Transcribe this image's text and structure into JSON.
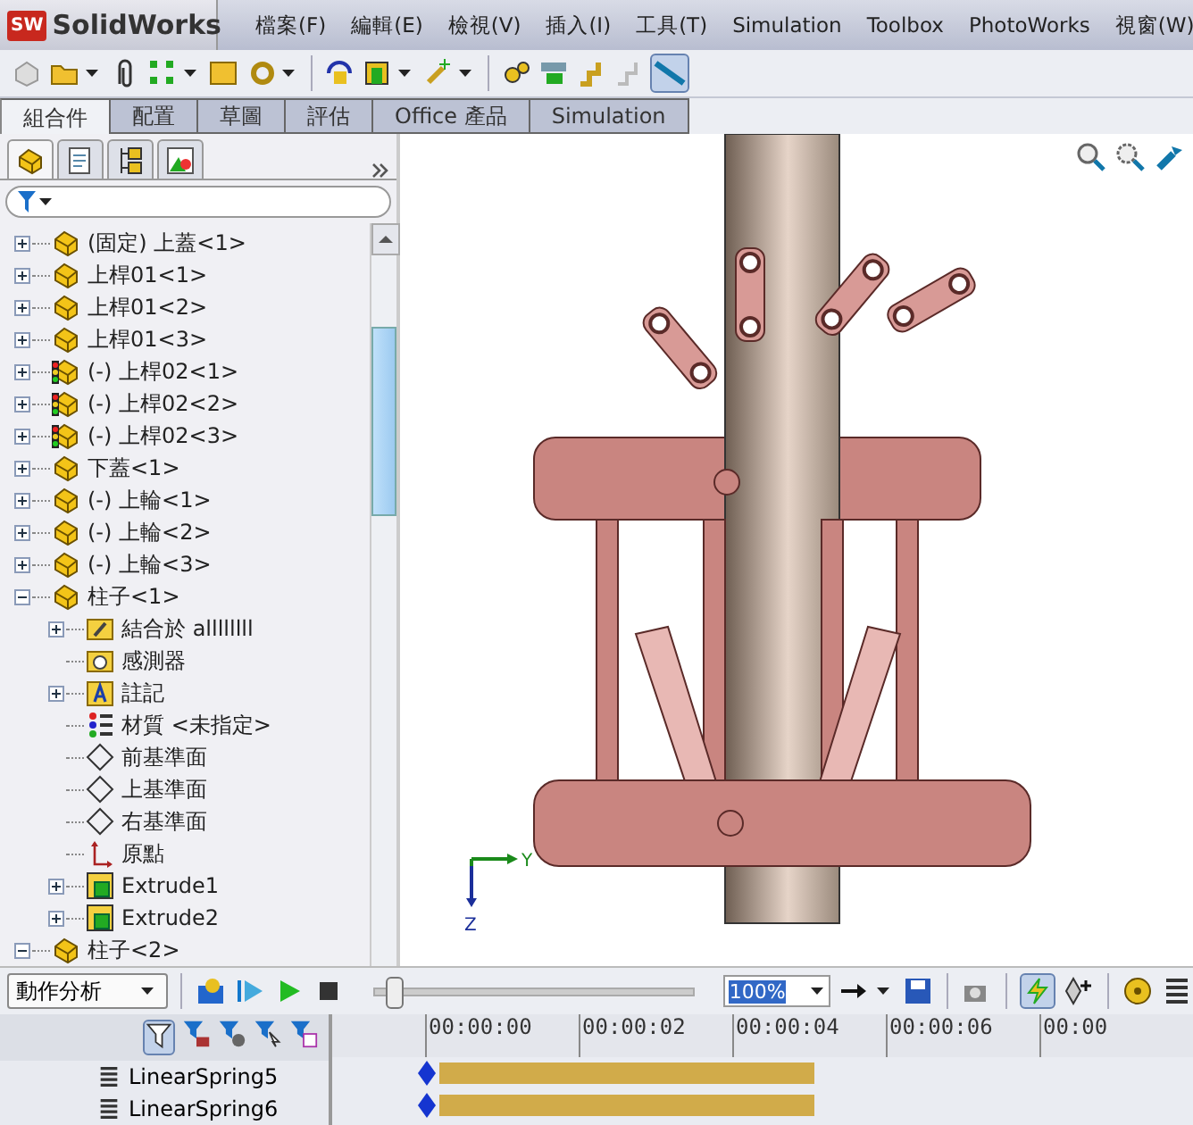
{
  "app": {
    "logo_badge": "SW",
    "logo_text": "SolidWorks"
  },
  "menu": [
    "檔案(F)",
    "編輯(E)",
    "檢視(V)",
    "插入(I)",
    "工具(T)",
    "Simulation",
    "Toolbox",
    "PhotoWorks",
    "視窗(W)"
  ],
  "command_tabs": [
    {
      "label": "組合件",
      "selected": true
    },
    {
      "label": "配置",
      "selected": false
    },
    {
      "label": "草圖",
      "selected": false
    },
    {
      "label": "評估",
      "selected": false
    },
    {
      "label": "Office 產品",
      "selected": false
    },
    {
      "label": "Simulation",
      "selected": false
    }
  ],
  "panel_tabs": [
    {
      "kind": "tree",
      "selected": true
    },
    {
      "kind": "property",
      "selected": false
    },
    {
      "kind": "config",
      "selected": false
    },
    {
      "kind": "display",
      "selected": false
    }
  ],
  "tree": [
    {
      "label": "(固定) 上蓋<1>",
      "kind": "part",
      "has_toggle": true,
      "expanded": false
    },
    {
      "label": "上桿01<1>",
      "kind": "part",
      "has_toggle": true,
      "expanded": false
    },
    {
      "label": "上桿01<2>",
      "kind": "part",
      "has_toggle": true,
      "expanded": false
    },
    {
      "label": "上桿01<3>",
      "kind": "part",
      "has_toggle": true,
      "expanded": false
    },
    {
      "label": "(-) 上桿02<1>",
      "kind": "part-light",
      "has_toggle": true,
      "expanded": false
    },
    {
      "label": "(-) 上桿02<2>",
      "kind": "part-light",
      "has_toggle": true,
      "expanded": false
    },
    {
      "label": "(-) 上桿02<3>",
      "kind": "part-light",
      "has_toggle": true,
      "expanded": false
    },
    {
      "label": "下蓋<1>",
      "kind": "part",
      "has_toggle": true,
      "expanded": false
    },
    {
      "label": "(-) 上輪<1>",
      "kind": "part",
      "has_toggle": true,
      "expanded": false
    },
    {
      "label": "(-) 上輪<2>",
      "kind": "part",
      "has_toggle": true,
      "expanded": false
    },
    {
      "label": "(-) 上輪<3>",
      "kind": "part",
      "has_toggle": true,
      "expanded": false
    },
    {
      "label": "柱子<1>",
      "kind": "part",
      "has_toggle": true,
      "expanded": true,
      "children": [
        {
          "label": "結合於 allllllll",
          "kind": "mates",
          "has_toggle": true,
          "expanded": false
        },
        {
          "label": "感測器",
          "kind": "sensor"
        },
        {
          "label": "註記",
          "kind": "annotation",
          "has_toggle": true,
          "expanded": false
        },
        {
          "label": "材質 <未指定>",
          "kind": "material"
        },
        {
          "label": "前基準面",
          "kind": "plane"
        },
        {
          "label": "上基準面",
          "kind": "plane"
        },
        {
          "label": "右基準面",
          "kind": "plane"
        },
        {
          "label": "原點",
          "kind": "origin"
        },
        {
          "label": "Extrude1",
          "kind": "extrude",
          "has_toggle": true,
          "expanded": false
        },
        {
          "label": "Extrude2",
          "kind": "extrude",
          "has_toggle": true,
          "expanded": false
        }
      ]
    },
    {
      "label": "柱子<2>",
      "kind": "part",
      "has_toggle": true,
      "expanded": true
    }
  ],
  "triad": {
    "x_axis": "Y",
    "y_axis": "Z"
  },
  "motion": {
    "study_type": "動作分析",
    "slider": {
      "level": 0.06
    },
    "zoom": "100%"
  },
  "timeline": {
    "ticks": [
      "00:00:00",
      "00:00:02",
      "00:00:04",
      "00:00:06",
      "00:00"
    ],
    "rows": [
      {
        "name": "LinearSpring5"
      },
      {
        "name": "LinearSpring6"
      }
    ]
  }
}
